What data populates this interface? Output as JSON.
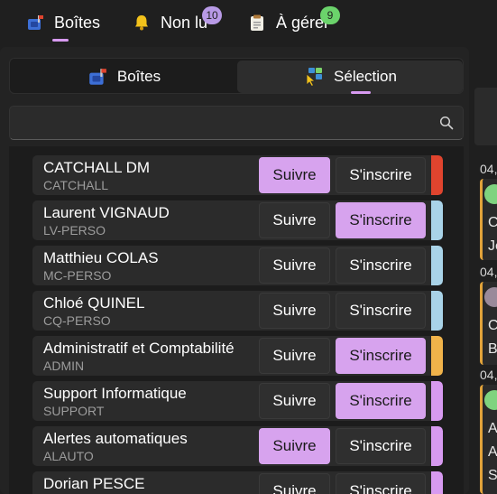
{
  "top_tabs": [
    {
      "label": "Boîtes",
      "icon": "mailbox-icon",
      "active": true
    },
    {
      "label": "Non lu",
      "icon": "bell-icon",
      "badge": "10",
      "badge_color": "#b89ae6"
    },
    {
      "label": "À gérer",
      "icon": "clipboard-icon",
      "badge": "9",
      "badge_color": "#6bd36b"
    }
  ],
  "segment": {
    "boites_label": "Boîtes",
    "selection_label": "Sélection",
    "active": "selection"
  },
  "search": {
    "value": "",
    "placeholder": ""
  },
  "accent_color": "#d7a3ee",
  "mailboxes": [
    {
      "name": "CATCHALL DM",
      "code": "CATCHALL",
      "follow": "Suivre",
      "subscribe": "S'inscrire",
      "following": true,
      "subscribed": false,
      "color": "#e0442e"
    },
    {
      "name": "Laurent VIGNAUD",
      "code": "LV-PERSO",
      "follow": "Suivre",
      "subscribe": "S'inscrire",
      "following": false,
      "subscribed": true,
      "color": "#a9d3e8"
    },
    {
      "name": "Matthieu COLAS",
      "code": "MC-PERSO",
      "follow": "Suivre",
      "subscribe": "S'inscrire",
      "following": false,
      "subscribed": false,
      "color": "#a9d3e8"
    },
    {
      "name": "Chloé QUINEL",
      "code": "CQ-PERSO",
      "follow": "Suivre",
      "subscribe": "S'inscrire",
      "following": false,
      "subscribed": false,
      "color": "#a9d3e8"
    },
    {
      "name": "Administratif et Comptabilité",
      "code": "ADMIN",
      "follow": "Suivre",
      "subscribe": "S'inscrire",
      "following": false,
      "subscribed": true,
      "color": "#f0b34a"
    },
    {
      "name": "Support Informatique",
      "code": "SUPPORT",
      "follow": "Suivre",
      "subscribe": "S'inscrire",
      "following": false,
      "subscribed": true,
      "color": "#d79af0"
    },
    {
      "name": "Alertes automatiques",
      "code": "ALAUTO",
      "follow": "Suivre",
      "subscribe": "S'inscrire",
      "following": true,
      "subscribed": false,
      "color": "#d79af0"
    },
    {
      "name": "Dorian PESCE",
      "code": "",
      "follow": "Suivre",
      "subscribe": "S'inscrire",
      "following": false,
      "subscribed": false,
      "color": "#d79af0"
    }
  ],
  "right_pane": {
    "items": [
      {
        "date": "04,",
        "avatar_color": "#7fd37f",
        "letters": [
          "C",
          "Je"
        ]
      },
      {
        "date": "04,",
        "avatar_color": "#9a8a9a",
        "letters": [
          "C",
          "B"
        ]
      },
      {
        "date": "04,",
        "avatar_color": "#7fd37f",
        "letters": [
          "A",
          "A",
          "S"
        ]
      }
    ]
  }
}
